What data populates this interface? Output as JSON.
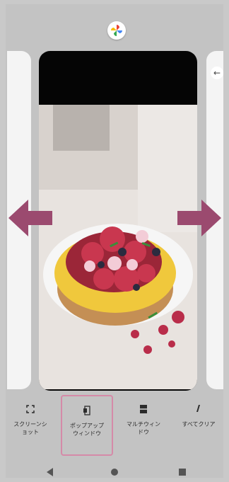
{
  "actions": [
    {
      "label": "スクリーンシ\nョット",
      "icon": "screenshot-icon"
    },
    {
      "label": "ポップアップ\nウィンドウ",
      "icon": "popup-window-icon"
    },
    {
      "label": "マルチウィン\nドウ",
      "icon": "multi-window-icon"
    },
    {
      "label": "すべてクリア",
      "icon": "clear-all-icon"
    }
  ],
  "selected_action": 1,
  "colors": {
    "swipe_arrow": "#9b4a6f",
    "highlight": "#d58aa8",
    "background": "#c9c9c9"
  },
  "navbar": {
    "back": "back-icon",
    "home": "home-icon",
    "recents": "recents-icon"
  }
}
